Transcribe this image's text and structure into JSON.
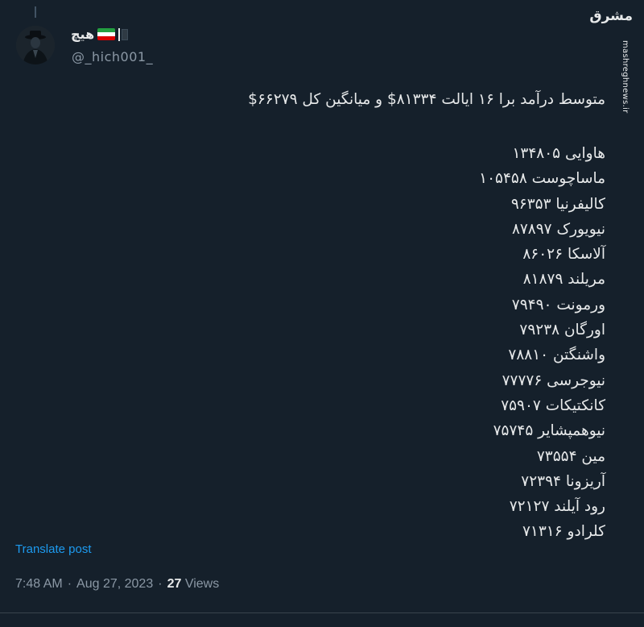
{
  "author": {
    "display_name": "هیچ",
    "handle": "@_hich001_"
  },
  "watermark": {
    "logo_text": "مشرق",
    "url": "mashreghnews.ir"
  },
  "tweet": {
    "headline": "متوسط درآمد برا ۱۶ ایالت ۸۱۳۳۴$ و میانگین کل ۶۶۲۷۹$",
    "states": [
      "هاوایی ۱۳۴۸۰۵",
      "ماساچوست ۱۰۵۴۵۸",
      "کالیفرنیا ۹۶۳۵۳",
      "نیویورک ۸۷۸۹۷",
      "آلاسکا ۸۶۰۲۶",
      "مریلند ۸۱۸۷۹",
      "ورمونت ۷۹۴۹۰",
      "اورگان ۷۹۲۳۸",
      "واشنگتن ۷۸۸۱۰",
      "نیوجرسی ۷۷۷۷۶",
      "کانکتیکات ۷۵۹۰۷",
      "نیوهمپشایر ۷۵۷۴۵",
      "مین ۷۳۵۵۴",
      "آریزونا ۷۲۳۹۴",
      "رود آیلند ۷۲۱۲۷",
      "کلرادو ۷۱۳۱۶"
    ]
  },
  "translate_label": "Translate post",
  "meta": {
    "time": "7:48 AM",
    "dot1": "·",
    "date": "Aug 27, 2023",
    "dot2": "·",
    "views_count": "27",
    "views_label": "Views"
  },
  "colors": {
    "background": "#15202b",
    "text": "#e7e9ea",
    "muted": "#8b98a5",
    "link": "#1d9bf0"
  }
}
